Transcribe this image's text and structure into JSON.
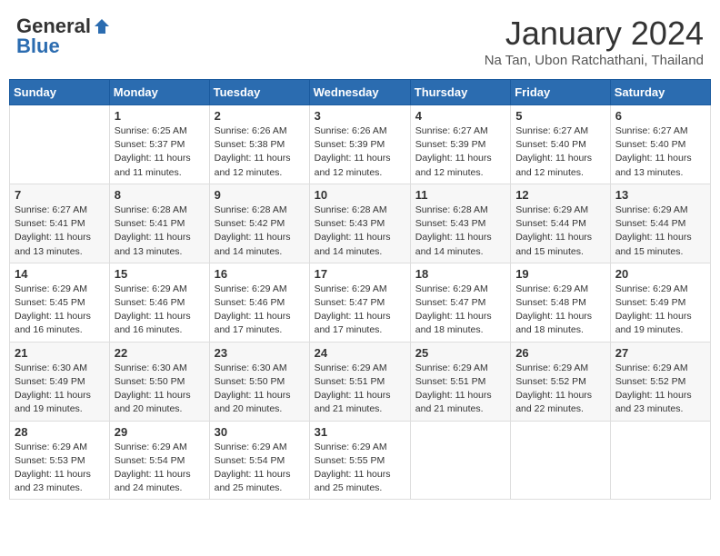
{
  "logo": {
    "general": "General",
    "blue": "Blue"
  },
  "title": "January 2024",
  "location": "Na Tan, Ubon Ratchathani, Thailand",
  "days_of_week": [
    "Sunday",
    "Monday",
    "Tuesday",
    "Wednesday",
    "Thursday",
    "Friday",
    "Saturday"
  ],
  "weeks": [
    [
      {
        "day": "",
        "info": ""
      },
      {
        "day": "1",
        "info": "Sunrise: 6:25 AM\nSunset: 5:37 PM\nDaylight: 11 hours\nand 11 minutes."
      },
      {
        "day": "2",
        "info": "Sunrise: 6:26 AM\nSunset: 5:38 PM\nDaylight: 11 hours\nand 12 minutes."
      },
      {
        "day": "3",
        "info": "Sunrise: 6:26 AM\nSunset: 5:39 PM\nDaylight: 11 hours\nand 12 minutes."
      },
      {
        "day": "4",
        "info": "Sunrise: 6:27 AM\nSunset: 5:39 PM\nDaylight: 11 hours\nand 12 minutes."
      },
      {
        "day": "5",
        "info": "Sunrise: 6:27 AM\nSunset: 5:40 PM\nDaylight: 11 hours\nand 12 minutes."
      },
      {
        "day": "6",
        "info": "Sunrise: 6:27 AM\nSunset: 5:40 PM\nDaylight: 11 hours\nand 13 minutes."
      }
    ],
    [
      {
        "day": "7",
        "info": "Sunrise: 6:27 AM\nSunset: 5:41 PM\nDaylight: 11 hours\nand 13 minutes."
      },
      {
        "day": "8",
        "info": "Sunrise: 6:28 AM\nSunset: 5:41 PM\nDaylight: 11 hours\nand 13 minutes."
      },
      {
        "day": "9",
        "info": "Sunrise: 6:28 AM\nSunset: 5:42 PM\nDaylight: 11 hours\nand 14 minutes."
      },
      {
        "day": "10",
        "info": "Sunrise: 6:28 AM\nSunset: 5:43 PM\nDaylight: 11 hours\nand 14 minutes."
      },
      {
        "day": "11",
        "info": "Sunrise: 6:28 AM\nSunset: 5:43 PM\nDaylight: 11 hours\nand 14 minutes."
      },
      {
        "day": "12",
        "info": "Sunrise: 6:29 AM\nSunset: 5:44 PM\nDaylight: 11 hours\nand 15 minutes."
      },
      {
        "day": "13",
        "info": "Sunrise: 6:29 AM\nSunset: 5:44 PM\nDaylight: 11 hours\nand 15 minutes."
      }
    ],
    [
      {
        "day": "14",
        "info": "Sunrise: 6:29 AM\nSunset: 5:45 PM\nDaylight: 11 hours\nand 16 minutes."
      },
      {
        "day": "15",
        "info": "Sunrise: 6:29 AM\nSunset: 5:46 PM\nDaylight: 11 hours\nand 16 minutes."
      },
      {
        "day": "16",
        "info": "Sunrise: 6:29 AM\nSunset: 5:46 PM\nDaylight: 11 hours\nand 17 minutes."
      },
      {
        "day": "17",
        "info": "Sunrise: 6:29 AM\nSunset: 5:47 PM\nDaylight: 11 hours\nand 17 minutes."
      },
      {
        "day": "18",
        "info": "Sunrise: 6:29 AM\nSunset: 5:47 PM\nDaylight: 11 hours\nand 18 minutes."
      },
      {
        "day": "19",
        "info": "Sunrise: 6:29 AM\nSunset: 5:48 PM\nDaylight: 11 hours\nand 18 minutes."
      },
      {
        "day": "20",
        "info": "Sunrise: 6:29 AM\nSunset: 5:49 PM\nDaylight: 11 hours\nand 19 minutes."
      }
    ],
    [
      {
        "day": "21",
        "info": "Sunrise: 6:30 AM\nSunset: 5:49 PM\nDaylight: 11 hours\nand 19 minutes."
      },
      {
        "day": "22",
        "info": "Sunrise: 6:30 AM\nSunset: 5:50 PM\nDaylight: 11 hours\nand 20 minutes."
      },
      {
        "day": "23",
        "info": "Sunrise: 6:30 AM\nSunset: 5:50 PM\nDaylight: 11 hours\nand 20 minutes."
      },
      {
        "day": "24",
        "info": "Sunrise: 6:29 AM\nSunset: 5:51 PM\nDaylight: 11 hours\nand 21 minutes."
      },
      {
        "day": "25",
        "info": "Sunrise: 6:29 AM\nSunset: 5:51 PM\nDaylight: 11 hours\nand 21 minutes."
      },
      {
        "day": "26",
        "info": "Sunrise: 6:29 AM\nSunset: 5:52 PM\nDaylight: 11 hours\nand 22 minutes."
      },
      {
        "day": "27",
        "info": "Sunrise: 6:29 AM\nSunset: 5:52 PM\nDaylight: 11 hours\nand 23 minutes."
      }
    ],
    [
      {
        "day": "28",
        "info": "Sunrise: 6:29 AM\nSunset: 5:53 PM\nDaylight: 11 hours\nand 23 minutes."
      },
      {
        "day": "29",
        "info": "Sunrise: 6:29 AM\nSunset: 5:54 PM\nDaylight: 11 hours\nand 24 minutes."
      },
      {
        "day": "30",
        "info": "Sunrise: 6:29 AM\nSunset: 5:54 PM\nDaylight: 11 hours\nand 25 minutes."
      },
      {
        "day": "31",
        "info": "Sunrise: 6:29 AM\nSunset: 5:55 PM\nDaylight: 11 hours\nand 25 minutes."
      },
      {
        "day": "",
        "info": ""
      },
      {
        "day": "",
        "info": ""
      },
      {
        "day": "",
        "info": ""
      }
    ]
  ]
}
